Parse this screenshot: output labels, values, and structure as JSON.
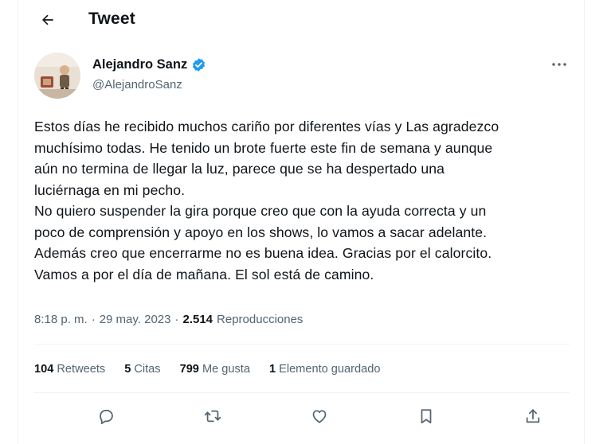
{
  "header": {
    "title": "Tweet",
    "back_icon": "arrow-left-icon"
  },
  "author": {
    "display_name": "Alejandro Sanz",
    "handle": "@AlejandroSanz",
    "verified_icon": "verified-badge-icon",
    "verified_color": "#1d9bf0"
  },
  "tweet": {
    "lines": [
      "Estos días he recibido muchos cariño por diferentes vías y Las agradezco",
      "muchísimo todas. He tenido un brote fuerte este fin de semana y aunque",
      "aún no termina de llegar la luz, parece que se ha despertado una",
      "luciérnaga en mi pecho.",
      "No quiero suspender la gira porque creo que con la ayuda correcta y un",
      "poco de comprensión y apoyo en los shows, lo vamos a sacar adelante.",
      "Además creo que encerrarme no es buena idea. Gracias por el calorcito.",
      "Vamos a por el día de mañana. El sol está de camino."
    ]
  },
  "meta": {
    "time": "8:18 p. m.",
    "separator": "·",
    "date": "29 may. 2023",
    "views_count": "2.514",
    "views_label": "Reproducciones"
  },
  "stats": {
    "retweets_count": "104",
    "retweets_label": "Retweets",
    "quotes_count": "5",
    "quotes_label": "Citas",
    "likes_count": "799",
    "likes_label": "Me gusta",
    "bookmarks_count": "1",
    "bookmarks_label": "Elemento guardado"
  },
  "actions": [
    "reply-icon",
    "retweet-icon",
    "like-icon",
    "bookmark-icon",
    "share-icon"
  ],
  "colors": {
    "text": "#0f1419",
    "secondary": "#536471",
    "divider": "#eff3f4",
    "accent": "#1d9bf0"
  }
}
